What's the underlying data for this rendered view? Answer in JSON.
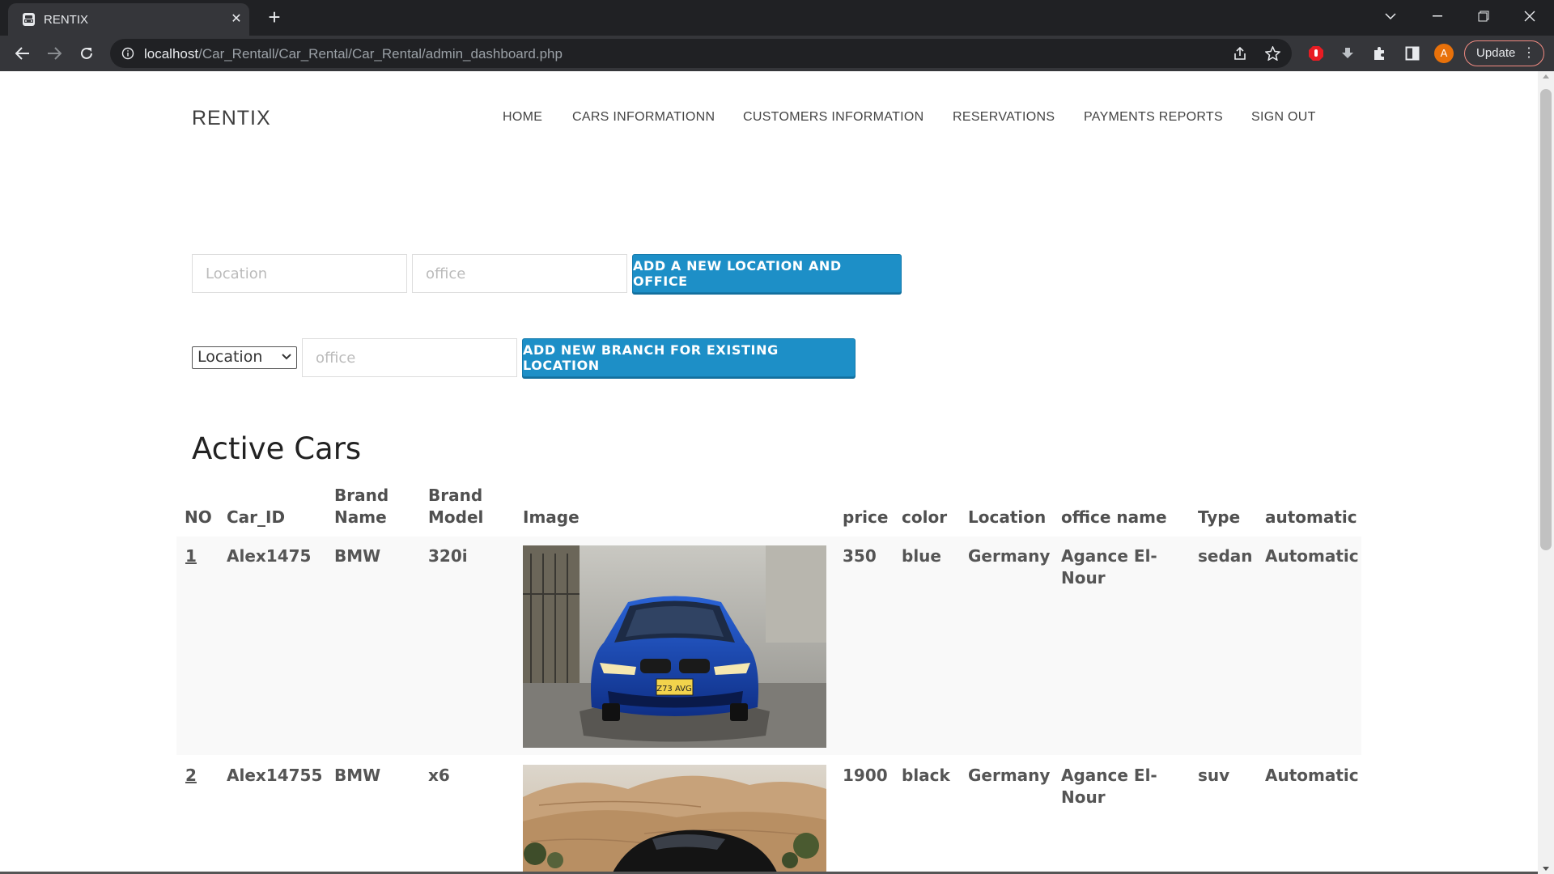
{
  "browser": {
    "tab_title": "RENTIX",
    "url_host": "localhost",
    "url_path": "/Car_Rentall/Car_Rental/Car_Rental/admin_dashboard.php",
    "profile_initial": "A",
    "update_label": "Update"
  },
  "site": {
    "brand": "RENTIX",
    "nav": [
      "HOME",
      "CARS INFORMATIONN",
      "CUSTOMERS INFORMATION",
      "RESERVATIONS",
      "PAYMENTS REPORTS",
      "SIGN OUT"
    ]
  },
  "forms": {
    "new_location": {
      "location_placeholder": "Location",
      "office_placeholder": "office",
      "button_label": "ADD A NEW LOCATION AND OFFICE"
    },
    "new_branch": {
      "location_select_value": "Location",
      "office_placeholder": "office",
      "button_label": "ADD NEW BRANCH FOR EXISTING LOCATION"
    }
  },
  "active_cars": {
    "title": "Active Cars",
    "columns": {
      "no": "NO",
      "car_id": "Car_ID",
      "brand_name_1": "Brand",
      "brand_name_2": "Name",
      "brand_model_1": "Brand",
      "brand_model_2": "Model",
      "image": "Image",
      "price": "price",
      "color": "color",
      "location": "Location",
      "office_name": "office name",
      "type": "Type",
      "automatic": "automatic"
    },
    "rows": [
      {
        "no": "1",
        "car_id": "Alex1475",
        "brand_name": "BMW",
        "brand_model": "320i",
        "price": "350",
        "color": "blue",
        "location": "Germany",
        "office_line1": "Agance El-",
        "office_line2": "Nour",
        "type": "sedan",
        "automatic": "Automatic",
        "image_label": "blue BMW 320i sedan"
      },
      {
        "no": "2",
        "car_id": "Alex14755",
        "brand_name": "BMW",
        "brand_model": "x6",
        "price": "1900",
        "color": "black",
        "location": "Germany",
        "office_line1": "Agance El-",
        "office_line2": "Nour",
        "type": "suv",
        "automatic": "Automatic",
        "image_label": "black BMW x6 in desert"
      }
    ]
  },
  "colors": {
    "chrome_dark": "#202124",
    "chrome_mid": "#35363a",
    "button_blue": "#1d8fc7",
    "row_background": "#f9f9f9",
    "car_blue": "#1846b8"
  }
}
